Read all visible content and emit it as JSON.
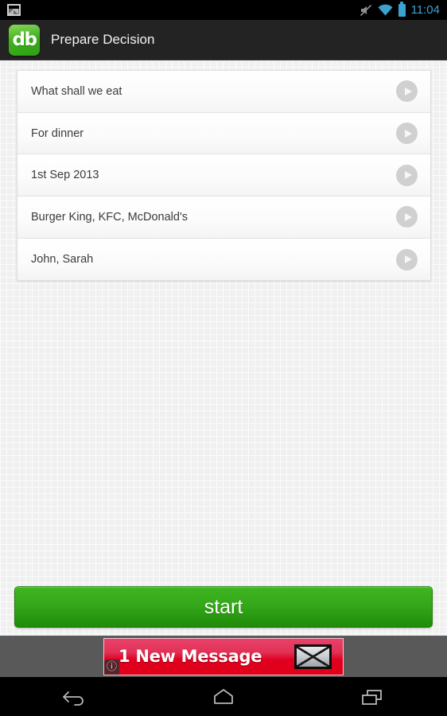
{
  "status_bar": {
    "notification_icon": "screenshot-icon",
    "mute_icon": "mute-icon",
    "wifi_icon": "wifi-icon",
    "battery_icon": "battery-icon",
    "clock": "11:04",
    "accent_color": "#3ba3d0",
    "background_color": "#000000"
  },
  "action_bar": {
    "app_icon_text": "db",
    "app_icon_color": "#3bb01a",
    "title": "Prepare Decision",
    "background_color": "#232323"
  },
  "list": {
    "go_icon": "play-circle-icon",
    "rows": [
      {
        "label": "What shall we eat"
      },
      {
        "label": "For dinner"
      },
      {
        "label": "1st Sep 2013"
      },
      {
        "label": "Burger King, KFC, McDonald's"
      },
      {
        "label": "John, Sarah"
      }
    ]
  },
  "start_button": {
    "label": "start",
    "color": "#35a81a"
  },
  "ad": {
    "text": "1 New Message",
    "envelope_icon": "envelope-icon",
    "info_badge": "ⓘ",
    "background_color": "#e00020"
  },
  "nav_bar": {
    "back": "back-icon",
    "home": "home-icon",
    "recents": "recents-icon"
  }
}
